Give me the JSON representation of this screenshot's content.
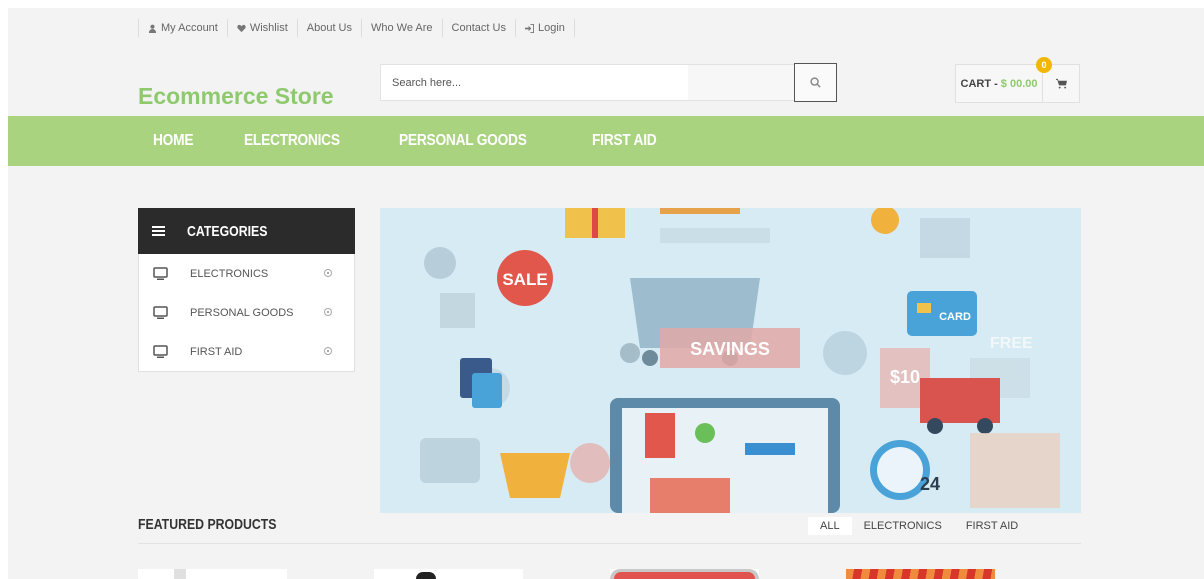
{
  "topbar": {
    "items": [
      {
        "label": "My Account",
        "icon": "user-icon"
      },
      {
        "label": "Wishlist",
        "icon": "heart-icon"
      },
      {
        "label": "About Us"
      },
      {
        "label": "Who We Are"
      },
      {
        "label": "Contact Us"
      },
      {
        "label": "Login",
        "icon": "sign-in-icon"
      }
    ]
  },
  "header": {
    "logo": "Ecommerce Store",
    "search_placeholder": "Search here...",
    "cart_label": "CART -",
    "cart_amount": "$ 00.00",
    "cart_count": "0"
  },
  "nav": {
    "items": [
      "HOME",
      "ELECTRONICS",
      "PERSONAL GOODS",
      "FIRST AID"
    ]
  },
  "categories": {
    "title": "CATEGORIES",
    "items": [
      "ELECTRONICS",
      "PERSONAL GOODS",
      "FIRST AID"
    ]
  },
  "banner": {
    "sale": "SALE",
    "savings": "SAVINGS",
    "card": "CARD",
    "price": "$10",
    "clock": "24",
    "free": "FREE"
  },
  "featured": {
    "title": "FEATURED PRODUCTS",
    "filters": [
      "ALL",
      "ELECTRONICS",
      "FIRST AID"
    ]
  },
  "colors": {
    "accent": "#8fc96e",
    "nav_bg": "#aad380",
    "badge": "#f2b705"
  }
}
